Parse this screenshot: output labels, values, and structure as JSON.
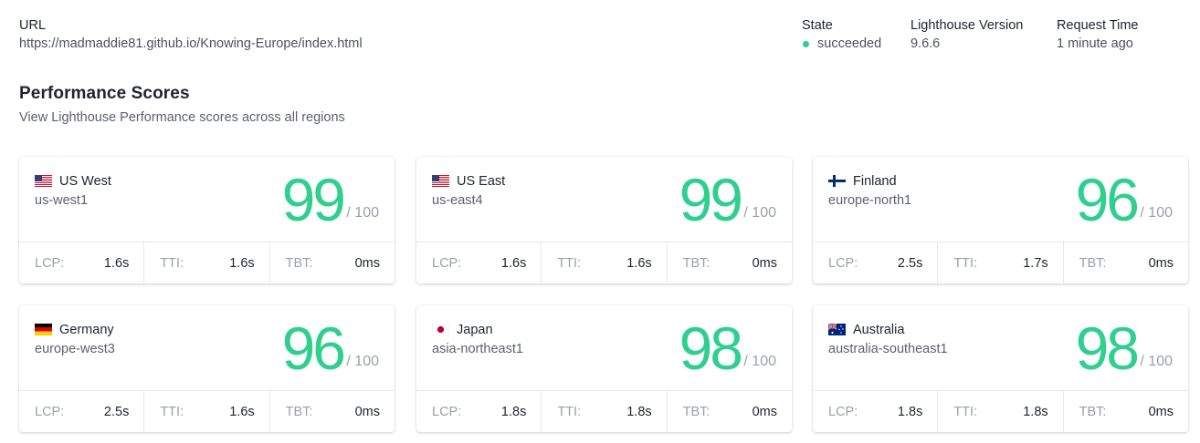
{
  "header": {
    "url_label": "URL",
    "url_value": "https://madmaddie81.github.io/Knowing-Europe/index.html",
    "state_label": "State",
    "state_value": "succeeded",
    "version_label": "Lighthouse Version",
    "version_value": "9.6.6",
    "time_label": "Request Time",
    "time_value": "1 minute ago"
  },
  "section": {
    "title": "Performance Scores",
    "subtitle": "View Lighthouse Performance scores across all regions"
  },
  "colors": {
    "score": "#2fcf8f",
    "state_dot": "#2fcf8f"
  },
  "regions": [
    {
      "name": "US West",
      "code": "us-west1",
      "flag": "us-flag-icon",
      "score": "99",
      "max": "/ 100",
      "metrics": [
        {
          "label": "LCP:",
          "value": "1.6s"
        },
        {
          "label": "TTI:",
          "value": "1.6s"
        },
        {
          "label": "TBT:",
          "value": "0ms"
        }
      ]
    },
    {
      "name": "US East",
      "code": "us-east4",
      "flag": "us-flag-icon",
      "score": "99",
      "max": "/ 100",
      "metrics": [
        {
          "label": "LCP:",
          "value": "1.6s"
        },
        {
          "label": "TTI:",
          "value": "1.6s"
        },
        {
          "label": "TBT:",
          "value": "0ms"
        }
      ]
    },
    {
      "name": "Finland",
      "code": "europe-north1",
      "flag": "finland-flag-icon",
      "score": "96",
      "max": "/ 100",
      "metrics": [
        {
          "label": "LCP:",
          "value": "2.5s"
        },
        {
          "label": "TTI:",
          "value": "1.7s"
        },
        {
          "label": "TBT:",
          "value": "0ms"
        }
      ]
    },
    {
      "name": "Germany",
      "code": "europe-west3",
      "flag": "germany-flag-icon",
      "score": "96",
      "max": "/ 100",
      "metrics": [
        {
          "label": "LCP:",
          "value": "2.5s"
        },
        {
          "label": "TTI:",
          "value": "1.6s"
        },
        {
          "label": "TBT:",
          "value": "0ms"
        }
      ]
    },
    {
      "name": "Japan",
      "code": "asia-northeast1",
      "flag": "japan-flag-icon",
      "score": "98",
      "max": "/ 100",
      "metrics": [
        {
          "label": "LCP:",
          "value": "1.8s"
        },
        {
          "label": "TTI:",
          "value": "1.8s"
        },
        {
          "label": "TBT:",
          "value": "0ms"
        }
      ]
    },
    {
      "name": "Australia",
      "code": "australia-southeast1",
      "flag": "australia-flag-icon",
      "score": "98",
      "max": "/ 100",
      "metrics": [
        {
          "label": "LCP:",
          "value": "1.8s"
        },
        {
          "label": "TTI:",
          "value": "1.8s"
        },
        {
          "label": "TBT:",
          "value": "0ms"
        }
      ]
    }
  ]
}
